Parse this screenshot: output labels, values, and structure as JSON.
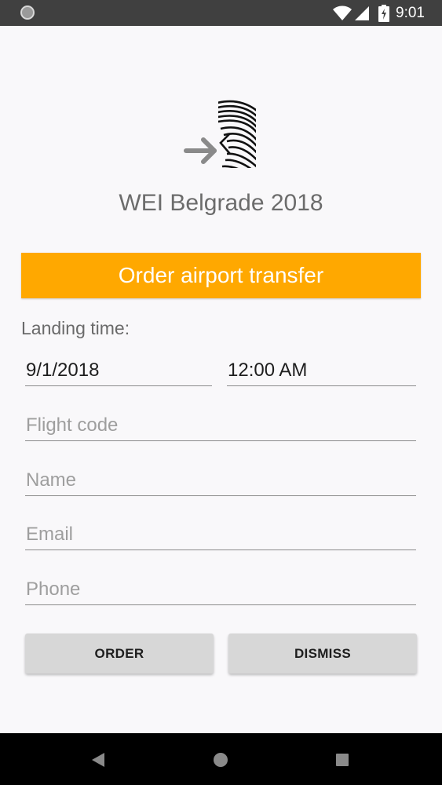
{
  "status_bar": {
    "time": "9:01"
  },
  "app": {
    "title": "WEI Belgrade 2018"
  },
  "banner": {
    "label": "Order airport transfer"
  },
  "form": {
    "landing_label": "Landing time:",
    "date_value": "9/1/2018",
    "time_value": "12:00 AM",
    "flight_code_placeholder": "Flight code",
    "name_placeholder": "Name",
    "email_placeholder": "Email",
    "phone_placeholder": "Phone"
  },
  "buttons": {
    "order": "ORDER",
    "dismiss": "DISMISS"
  },
  "colors": {
    "accent": "#ffa800",
    "status_bar": "#404040",
    "background": "#f9f8fa"
  },
  "icons": [
    "notification-dot-icon",
    "wifi-icon",
    "cellular-signal-icon",
    "battery-charging-icon",
    "app-logo-icon",
    "back-icon",
    "home-icon",
    "recents-icon"
  ]
}
